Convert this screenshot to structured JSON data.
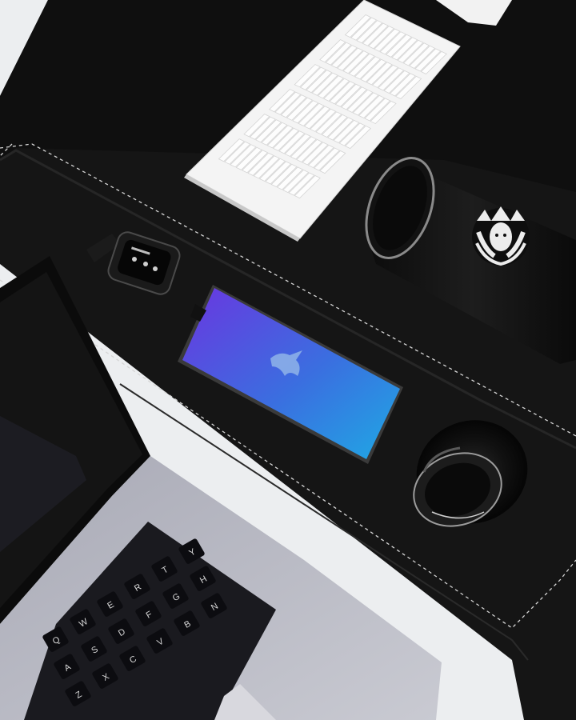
{
  "scene": {
    "type": "flat-lay desk photo",
    "colors": {
      "desk": "#eceef0",
      "mat": "#141414",
      "stitch": "#d9d9d9",
      "laptop_body": "#b9bac4",
      "screen_start": "#5b3ce0",
      "screen_end": "#1f9fe0",
      "keyboard": "#f3f3f3"
    }
  },
  "objects": {
    "keyboard": {
      "icon": "white-keyboard"
    },
    "watch": {
      "icon": "smartwatch",
      "screen_text": ""
    },
    "phone": {
      "icon": "smartphone",
      "wallpaper_icon": "unicorn-silhouette"
    },
    "tumbler": {
      "icon": "travel-tumbler",
      "logo": "siren-logo"
    },
    "lens": {
      "icon": "camera-lens"
    },
    "laptop": {
      "icon": "laptop",
      "keyboard_rows": [
        [
          "Q",
          "W",
          "E",
          "R",
          "T",
          "Y"
        ],
        [
          "A",
          "S",
          "D",
          "F",
          "G",
          "H"
        ],
        [
          "Z",
          "X",
          "C",
          "V",
          "B",
          "N"
        ]
      ]
    }
  }
}
